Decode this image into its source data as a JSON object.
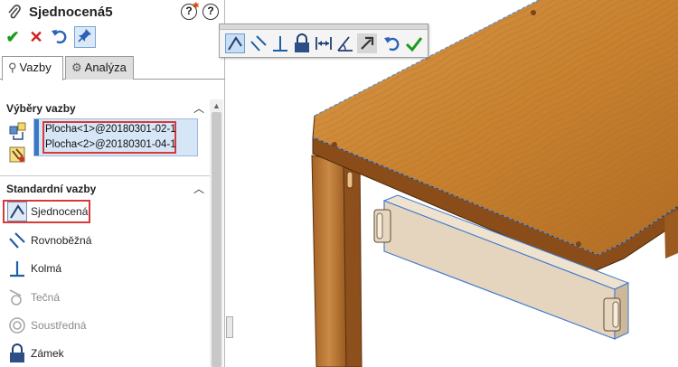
{
  "title": "Sjednocená5",
  "tabs": [
    {
      "label": "Vazby"
    },
    {
      "label": "Analýza"
    }
  ],
  "sections": {
    "selection": {
      "title": "Výběry vazby",
      "items": [
        "Plocha<1>@20180301-02-1",
        "Plocha<2>@20180301-04-1"
      ]
    },
    "standard": {
      "title": "Standardní vazby",
      "mates": [
        {
          "label": "Sjednocená",
          "icon": "coincident-icon",
          "enabled": true
        },
        {
          "label": "Rovnoběžná",
          "icon": "parallel-icon",
          "enabled": true
        },
        {
          "label": "Kolmá",
          "icon": "perpendicular-icon",
          "enabled": true
        },
        {
          "label": "Tečná",
          "icon": "tangent-icon",
          "enabled": false
        },
        {
          "label": "Soustředná",
          "icon": "concentric-icon",
          "enabled": false
        },
        {
          "label": "Zámek",
          "icon": "lock-icon",
          "enabled": true
        }
      ]
    }
  },
  "toolbar_icons": [
    "coincident-icon",
    "parallel-icon",
    "perpendicular-icon",
    "lock-icon",
    "distance-icon",
    "angle-icon",
    "flip-alignment-icon",
    "undo-icon",
    "ok-check-icon"
  ],
  "colors": {
    "accent": "#3a78c6",
    "highlight": "#d83a3a",
    "ok": "#1a9a1a",
    "cancel": "#d02020",
    "wood": "#c98a3a"
  }
}
